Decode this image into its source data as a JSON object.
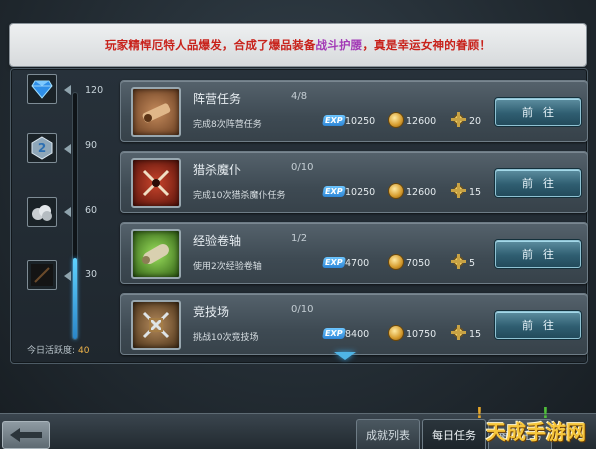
{
  "announcement": {
    "prefix": "玩家精悍厄特人品爆发，合成了爆品装备",
    "item": "战斗护腰",
    "suffix": "，真是幸运女神的眷顾！"
  },
  "activity": {
    "milestones": [
      {
        "value": "120",
        "icon": "diamond-icon"
      },
      {
        "value": "90",
        "icon": "silver-token-icon"
      },
      {
        "value": "60",
        "icon": "silver-ore-icon"
      },
      {
        "value": "30",
        "icon": "dark-item-icon"
      }
    ],
    "progress_fraction": 0.33,
    "footer_label": "今日活跃度:",
    "footer_value": "40"
  },
  "tasks": [
    {
      "name": "阵营任务",
      "progress": "4/8",
      "desc": "完成8次阵营任务",
      "exp_label": "EXP",
      "exp": "10250",
      "gold": "12600",
      "medal": "20",
      "button": "前往",
      "icon": "camp-task-icon",
      "icon_color": "#8a5a37"
    },
    {
      "name": "猎杀魔仆",
      "progress": "0/10",
      "desc": "完成10次猎杀魔仆任务",
      "exp_label": "EXP",
      "exp": "10250",
      "gold": "12600",
      "medal": "15",
      "button": "前往",
      "icon": "hunt-task-icon",
      "icon_color": "#8e2a1d"
    },
    {
      "name": "经验卷轴",
      "progress": "1/2",
      "desc": "使用2次经验卷轴",
      "exp_label": "EXP",
      "exp": "4700",
      "gold": "7050",
      "medal": "5",
      "button": "前往",
      "icon": "scroll-task-icon",
      "icon_color": "#4f8f2a"
    },
    {
      "name": "竞技场",
      "progress": "0/10",
      "desc": "挑战10次竞技场",
      "exp_label": "EXP",
      "exp": "8400",
      "gold": "10750",
      "medal": "15",
      "button": "前往",
      "icon": "arena-task-icon",
      "icon_color": "#6e5232"
    }
  ],
  "bottom": {
    "tabs": [
      {
        "label": "成就列表",
        "active": false
      },
      {
        "label": "每日任务",
        "active": true
      },
      {
        "label": "每日任务",
        "active": false
      }
    ],
    "watermark": "天成手游网"
  },
  "colors": {
    "announce_red": "#c8221b",
    "announce_highlight": "#a33bb6",
    "activity_bar": "#3aa8ee",
    "button_teal": "#2f5e71"
  }
}
